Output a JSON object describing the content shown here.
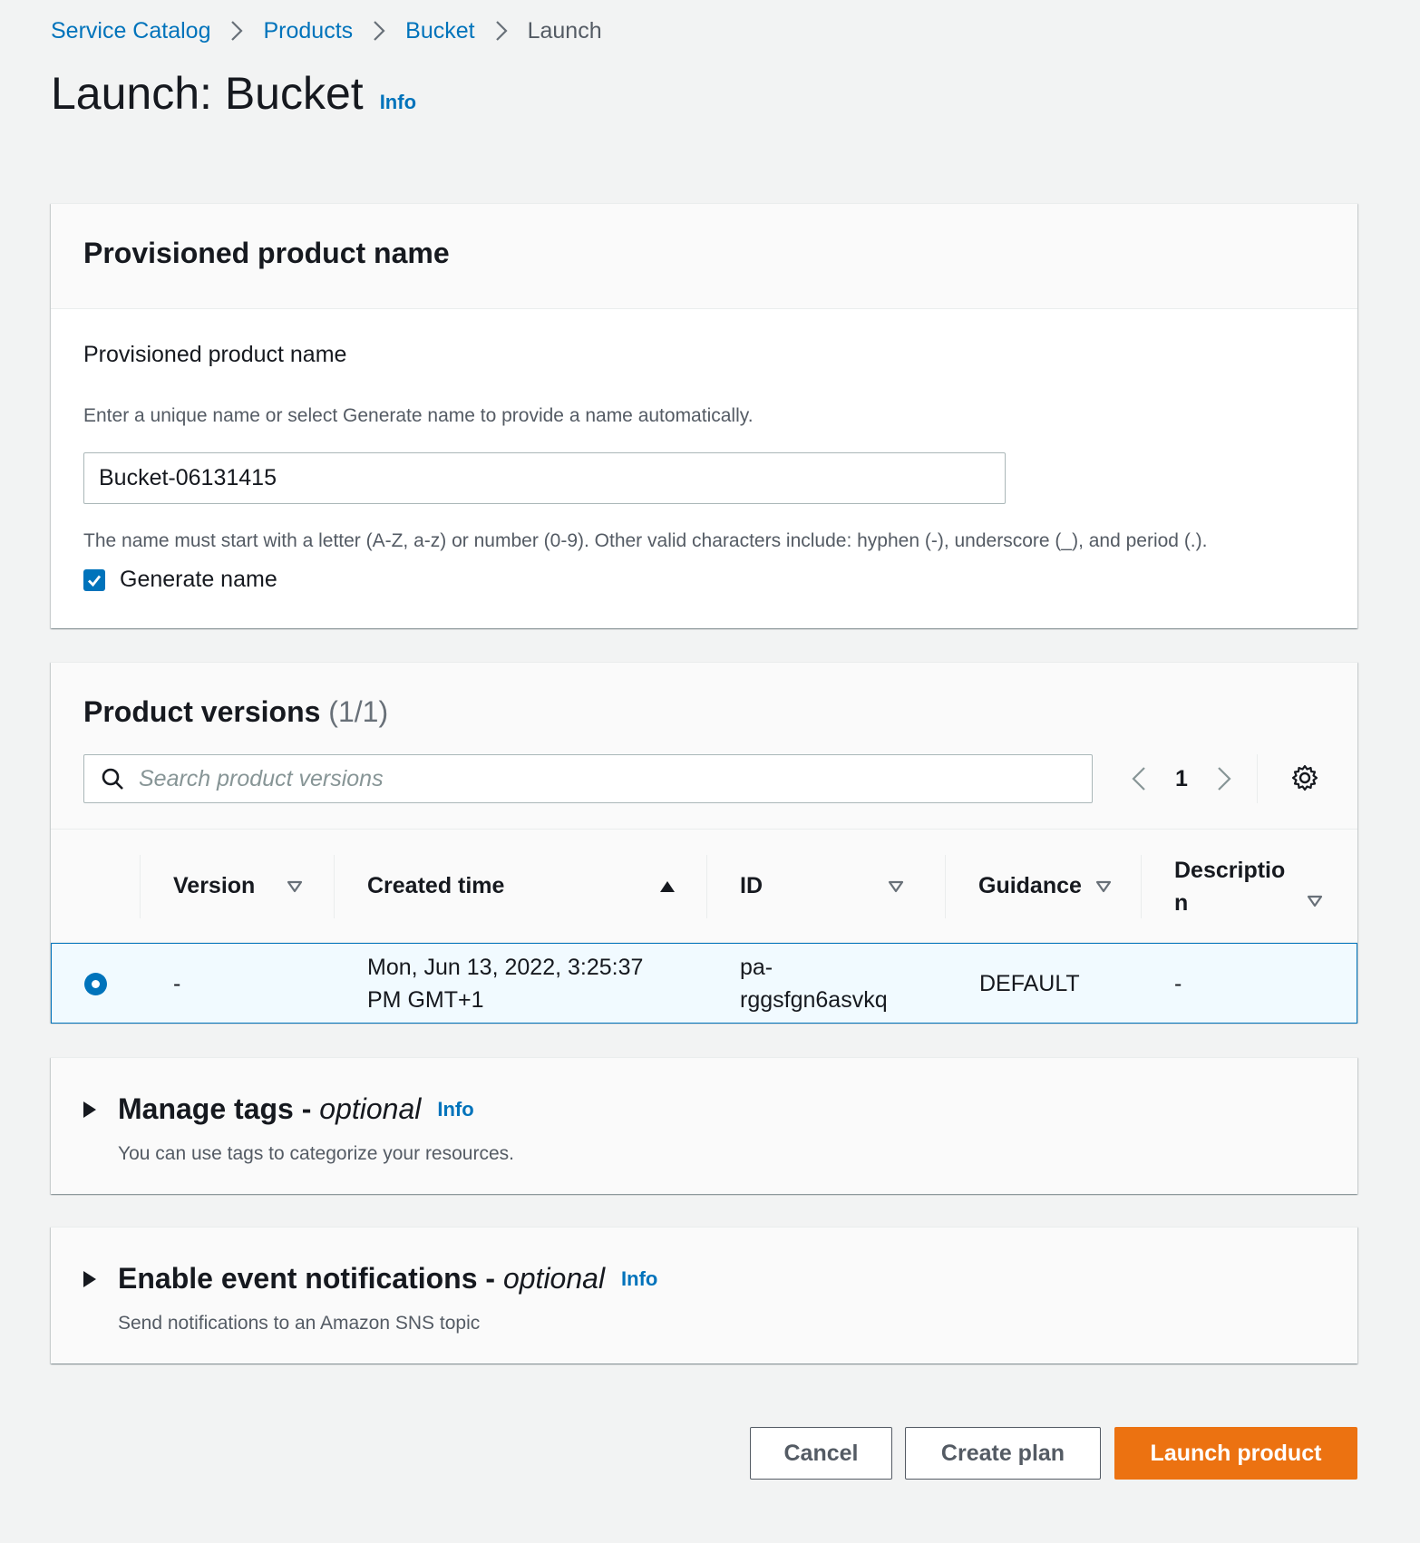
{
  "breadcrumb": {
    "items": [
      "Service Catalog",
      "Products",
      "Bucket"
    ],
    "current": "Launch"
  },
  "page": {
    "title": "Launch: Bucket",
    "info": "Info"
  },
  "name_panel": {
    "title": "Provisioned product name",
    "field_label": "Provisioned product name",
    "description": "Enter a unique name or select Generate name to provide a name automatically.",
    "value": "Bucket-06131415",
    "constraint": "The name must start with a letter (A-Z, a-z) or number (0-9). Other valid characters include: hyphen (-), underscore (_), and period (.).",
    "generate_label": "Generate name",
    "generate_checked": true
  },
  "versions_panel": {
    "title": "Product versions",
    "count": "(1/1)",
    "search_placeholder": "Search product versions",
    "page": "1",
    "columns": [
      "Version",
      "Created time",
      "ID",
      "Guidance",
      "Descriptio\nn"
    ],
    "rows": [
      {
        "version": "-",
        "created_line1": "Mon, Jun 13, 2022, 3:25:37",
        "created_line2": "PM GMT+1",
        "id_line1": "pa-",
        "id_line2": "rggsfgn6asvkq",
        "guidance": "DEFAULT",
        "description": "-",
        "selected": true
      }
    ]
  },
  "tags_panel": {
    "title": "Manage tags - ",
    "optional": "optional",
    "info": "Info",
    "description": "You can use tags to categorize your resources."
  },
  "events_panel": {
    "title": "Enable event notifications - ",
    "optional": "optional",
    "info": "Info",
    "description": "Send notifications to an Amazon SNS topic"
  },
  "footer": {
    "cancel": "Cancel",
    "create_plan": "Create plan",
    "launch": "Launch product"
  },
  "colors": {
    "link": "#0073bb",
    "primary_button": "#ec7211",
    "selected_row": "#f1faff"
  }
}
